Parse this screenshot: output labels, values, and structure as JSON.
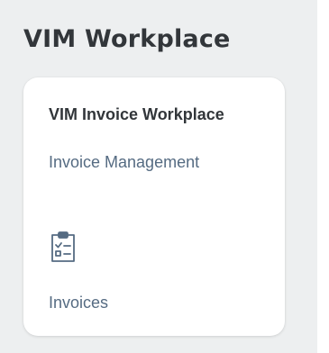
{
  "group": {
    "title": "VIM Workplace"
  },
  "tile": {
    "title": "VIM Invoice Workplace",
    "subtitle": "Invoice Management",
    "icon": "task-checklist-icon",
    "footer": "Invoices"
  },
  "colors": {
    "background": "#edeff0",
    "title_text": "#32363a",
    "secondary_text": "#556b82",
    "icon": "#556b82"
  }
}
